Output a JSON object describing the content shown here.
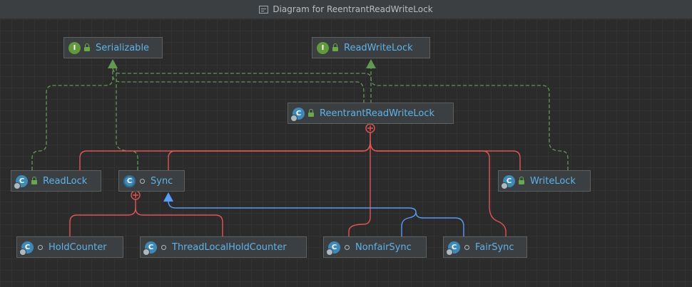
{
  "window": {
    "title": "Diagram for ReentrantReadWriteLock"
  },
  "colors": {
    "inner_class_edge": "#e05555",
    "realization_edge": "#629755",
    "inheritance_edge": "#589df6",
    "node_text": "#5fb2e7"
  },
  "nodes": {
    "serializable": {
      "label": "Serializable",
      "icon": "interface-icon",
      "icon_letter": "I"
    },
    "readwritelock": {
      "label": "ReadWriteLock",
      "icon": "interface-icon",
      "icon_letter": "I"
    },
    "reentrantreadwritelock": {
      "label": "ReentrantReadWriteLock",
      "icon": "class-icon",
      "icon_letter": "C"
    },
    "readlock": {
      "label": "ReadLock",
      "icon": "class-icon",
      "icon_letter": "C"
    },
    "sync": {
      "label": "Sync",
      "icon": "abstract-class-icon",
      "icon_letter": "C"
    },
    "writelock": {
      "label": "WriteLock",
      "icon": "class-icon",
      "icon_letter": "C"
    },
    "holdcounter": {
      "label": "HoldCounter",
      "icon": "class-icon",
      "icon_letter": "C"
    },
    "threadlocalholdcounter": {
      "label": "ThreadLocalHoldCounter",
      "icon": "class-icon",
      "icon_letter": "C"
    },
    "nonfairsync": {
      "label": "NonfairSync",
      "icon": "class-icon",
      "icon_letter": "C"
    },
    "fairsync": {
      "label": "FairSync",
      "icon": "class-icon",
      "icon_letter": "C"
    }
  }
}
